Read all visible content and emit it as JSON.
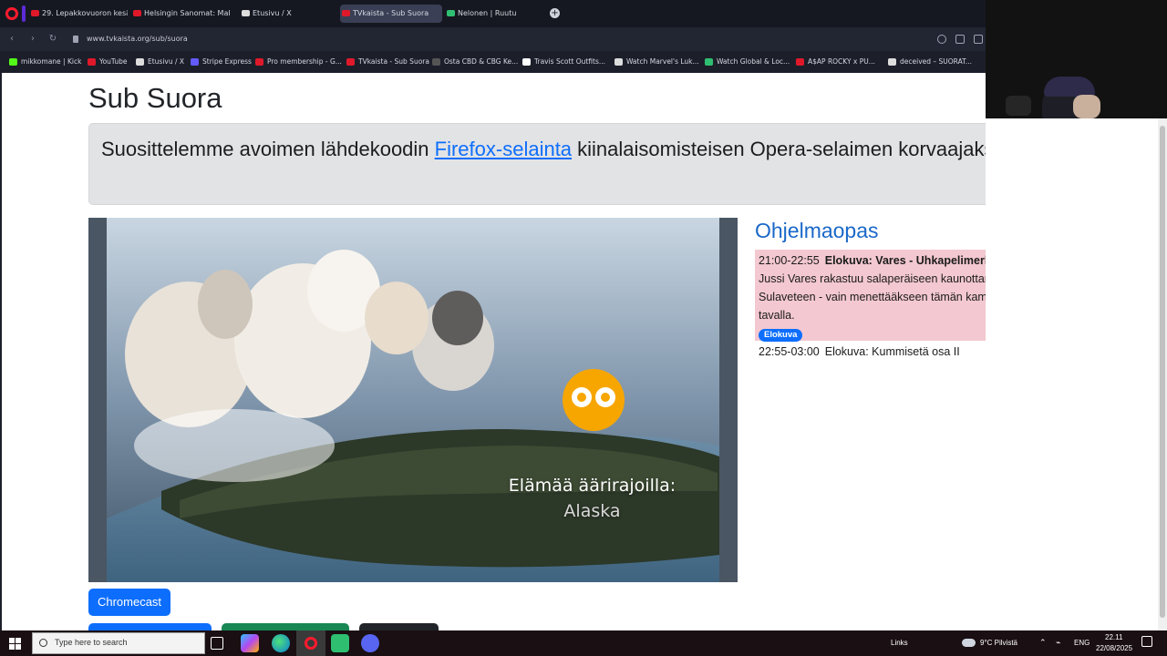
{
  "browser": {
    "tabs": [
      {
        "label": "29. Lepakkovuoron kesäsp",
        "fav_color": "#e0192a",
        "active": false
      },
      {
        "label": "Helsingin Sanomat: Maksu",
        "fav_color": "#e0192a",
        "active": false
      },
      {
        "label": "Etusivu / X",
        "fav_color": "#dddddd",
        "active": false
      },
      {
        "label": "TVkaista - Sub Suora",
        "fav_color": "#e0192a",
        "active": true
      },
      {
        "label": "Nelonen | Ruutu",
        "fav_color": "#2fbf71",
        "active": false
      }
    ],
    "url": "www.tvkaista.org/sub/suora",
    "bookmarks": [
      {
        "label": "mikkomane | Kick",
        "fav_color": "#53fc18"
      },
      {
        "label": "YouTube",
        "fav_color": "#e0192a"
      },
      {
        "label": "Etusivu / X",
        "fav_color": "#dddddd"
      },
      {
        "label": "Stripe Express",
        "fav_color": "#635bff"
      },
      {
        "label": "Pro membership - G...",
        "fav_color": "#e0192a"
      },
      {
        "label": "TVkaista - Sub Suora",
        "fav_color": "#e0192a"
      },
      {
        "label": "Osta CBD & CBG Ke...",
        "fav_color": "#555555"
      },
      {
        "label": "Travis Scott Outfits...",
        "fav_color": "#ffffff"
      },
      {
        "label": "Watch Marvel's Luk...",
        "fav_color": "#dddddd"
      },
      {
        "label": "Watch Global & Loc...",
        "fav_color": "#2fbf71"
      },
      {
        "label": "A$AP ROCKY x PU...",
        "fav_color": "#e0192a"
      },
      {
        "label": "deceived – SUORAT...",
        "fav_color": "#dddddd"
      }
    ]
  },
  "page": {
    "title": "Sub Suora",
    "alert": {
      "before": "Suosittelemme avoimen lähdekoodin ",
      "link": "Firefox-selainta",
      "after": " kiinalaisomisteisen Opera-selaimen korvaajaksi."
    },
    "video": {
      "title_line1": "Elämää äärirajoilla:",
      "title_line2": "Alaska"
    },
    "chromecast_label": "Chromecast",
    "guide": {
      "title": "Ohjelmaopas",
      "current": {
        "time": "21:00-22:55",
        "name": "Elokuva: Vares - Uhkapelimerkki",
        "description": "Jussi Vares rakastuu salaperäiseen kaunottareen Sole Sulaveteen - vain menettääkseen tämän kammottavalla tavalla.",
        "badge": "Elokuva"
      },
      "next": {
        "time": "22:55-03:00",
        "name": "Elokuva: Kummisetä osa II"
      }
    }
  },
  "taskbar": {
    "search_placeholder": "Type here to search",
    "links_label": "Links",
    "weather": "9°C  Pilvistä",
    "language": "ENG",
    "time": "22.11",
    "date": "22/08/2025"
  }
}
